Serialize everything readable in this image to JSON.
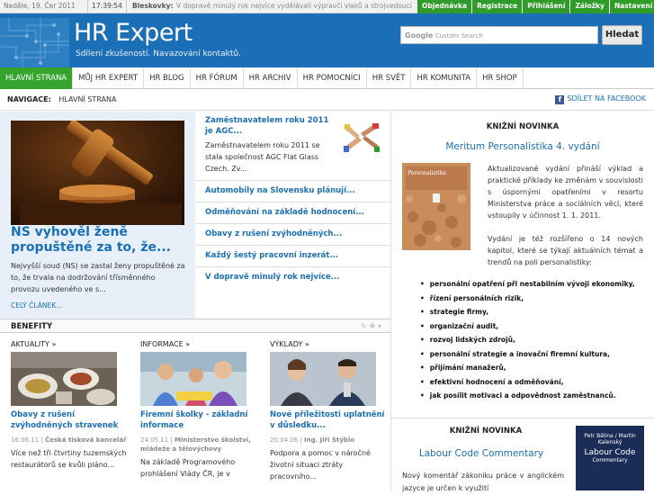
{
  "topbar": {
    "date": "Neděle, 19. Čer 2011",
    "time": "17:39:54",
    "news_label": "Bleskovky:",
    "ticker": "V dopravě minulý rok nejvíce vydělávali výpravčí vlaků a strojvedoucí",
    "nav": [
      "Objednávka",
      "Registrace",
      "Přihlášení",
      "Záložky",
      "Nastavení"
    ]
  },
  "header": {
    "title": "HR Expert",
    "subtitle": "Sdílení zkušeností. Navazování kontaktů.",
    "search_placeholder": "Custom Search",
    "search_google": "Google",
    "search_button": "Hledat"
  },
  "mainnav": [
    "HLAVNÍ STRANA",
    "MŮJ HR EXPERT",
    "HR BLOG",
    "HR FÓRUM",
    "HR ARCHIV",
    "HR POMOCNÍCI",
    "HR SVĚT",
    "HR KOMUNITA",
    "HR SHOP"
  ],
  "breadcrumb": {
    "label": "NAVIGACE:",
    "current": "HLAVNÍ STRANA",
    "share": "SDÍLET NA FACEBOOK"
  },
  "featured": {
    "headline": "NS vyhověl ženě propuštěné za to, že...",
    "teaser": "Nejvyšší soud (NS) se zastal ženy propuštěné za to, že trvala na dodržování třísměnného provozu uvedeného ve s...",
    "more": "CELÝ ČLÁNEK..."
  },
  "news": {
    "first_title": "Zaměstnavatelem roku 2011 je AGC...",
    "first_desc": "Zaměstnavatelem roku 2011 se stala společnost AGC Flat Glass Czech. Zv...",
    "items": [
      "Automobily na Slovensku plánují...",
      "Odměňování na základě hodnocení...",
      "Obavy z rušení zvýhodněných...",
      "Každý šestý pracovní inzerát...",
      "V dopravě minulý rok nejvíce..."
    ]
  },
  "benefity": {
    "title": "BENEFITY",
    "tools": "✎ ✥ ▾",
    "columns": [
      {
        "category": "AKTUALITY »",
        "title": "Obavy z rušení zvýhodněných stravenek",
        "date": "16.06.11",
        "source": "Česká tisková kancelář",
        "desc": "Více než tři čtvrtiny tuzemských restaurátorů se kvůli pláno..."
      },
      {
        "category": "INFORMACE »",
        "title": "Firemní školky - základní informace",
        "date": "24.05.11",
        "source": "Ministerstvo školství, mládeže a tělovýchovy",
        "desc": "Na základě Programového prohlášení Vlády ČR, je v"
      },
      {
        "category": "VÝKLADY »",
        "title": "Nové příležitosti uplatnění v důsledku...",
        "date": "20.04.06",
        "source": "Ing. Jiří Stýblo",
        "desc": "Podpora a pomoc v náročné životní situaci ztráty pracovního..."
      }
    ]
  },
  "book1": {
    "section": "KNIŽNÍ NOVINKA",
    "title": "Meritum Personalistika 4. vydání",
    "cover_text": "Personalistika",
    "desc1": "Aktualizované vydání přináší výklad a praktické příklady ke změnám v souvislosti s úspornými opatřeními v resortu Ministerstva práce a sociálních věcí, které vstoupily v účinnost 1. 1. 2011.",
    "desc2": "Vydání je též rozšířeno o 14 nových kapitol, které se týkají aktuálních témat a trendů na poli personalistiky:",
    "bullets": [
      "personální opatření při nestabilním vývoji ekonomiky,",
      "řízení personálních rizik,",
      "strategie firmy,",
      "organizační audit,",
      "rozvoj lidských zdrojů,",
      "personální strategie a inovační firemní kultura,",
      "přijímání manažerů,",
      "efektivní hodnocení a odměňování,",
      "jak posílit motivaci a odpovědnost zaměstnanců."
    ]
  },
  "book2": {
    "section": "KNIŽNÍ NOVINKA",
    "title": "Labour Code Commentary",
    "cover_small": "Petr Bělina / Martin Kalenský",
    "cover_name": "Labour Code",
    "cover_sub": "Commentary",
    "desc": "Nový komentář zákoníku práce v anglickém jazyce je určen k využití"
  },
  "colors": {
    "brand_blue": "#1b6fb6",
    "nav_green": "#35a32c",
    "link_blue": "#1b6fb6"
  }
}
